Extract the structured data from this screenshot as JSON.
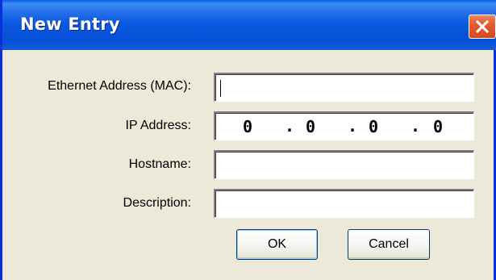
{
  "window": {
    "title": "New Entry"
  },
  "form": {
    "mac": {
      "label": "Ethernet Address (MAC):",
      "value": ""
    },
    "ip": {
      "label": "IP Address:",
      "octets": [
        "0",
        "0",
        "0",
        "0"
      ],
      "separator": "."
    },
    "hostname": {
      "label": "Hostname:",
      "value": ""
    },
    "description": {
      "label": "Description:",
      "value": ""
    }
  },
  "buttons": {
    "ok": "OK",
    "cancel": "Cancel"
  },
  "colors": {
    "titlebar": "#0a5ae0",
    "window_bg": "#ece9d8",
    "close_button": "#e35b2f"
  },
  "icons": {
    "close": "close-icon"
  }
}
